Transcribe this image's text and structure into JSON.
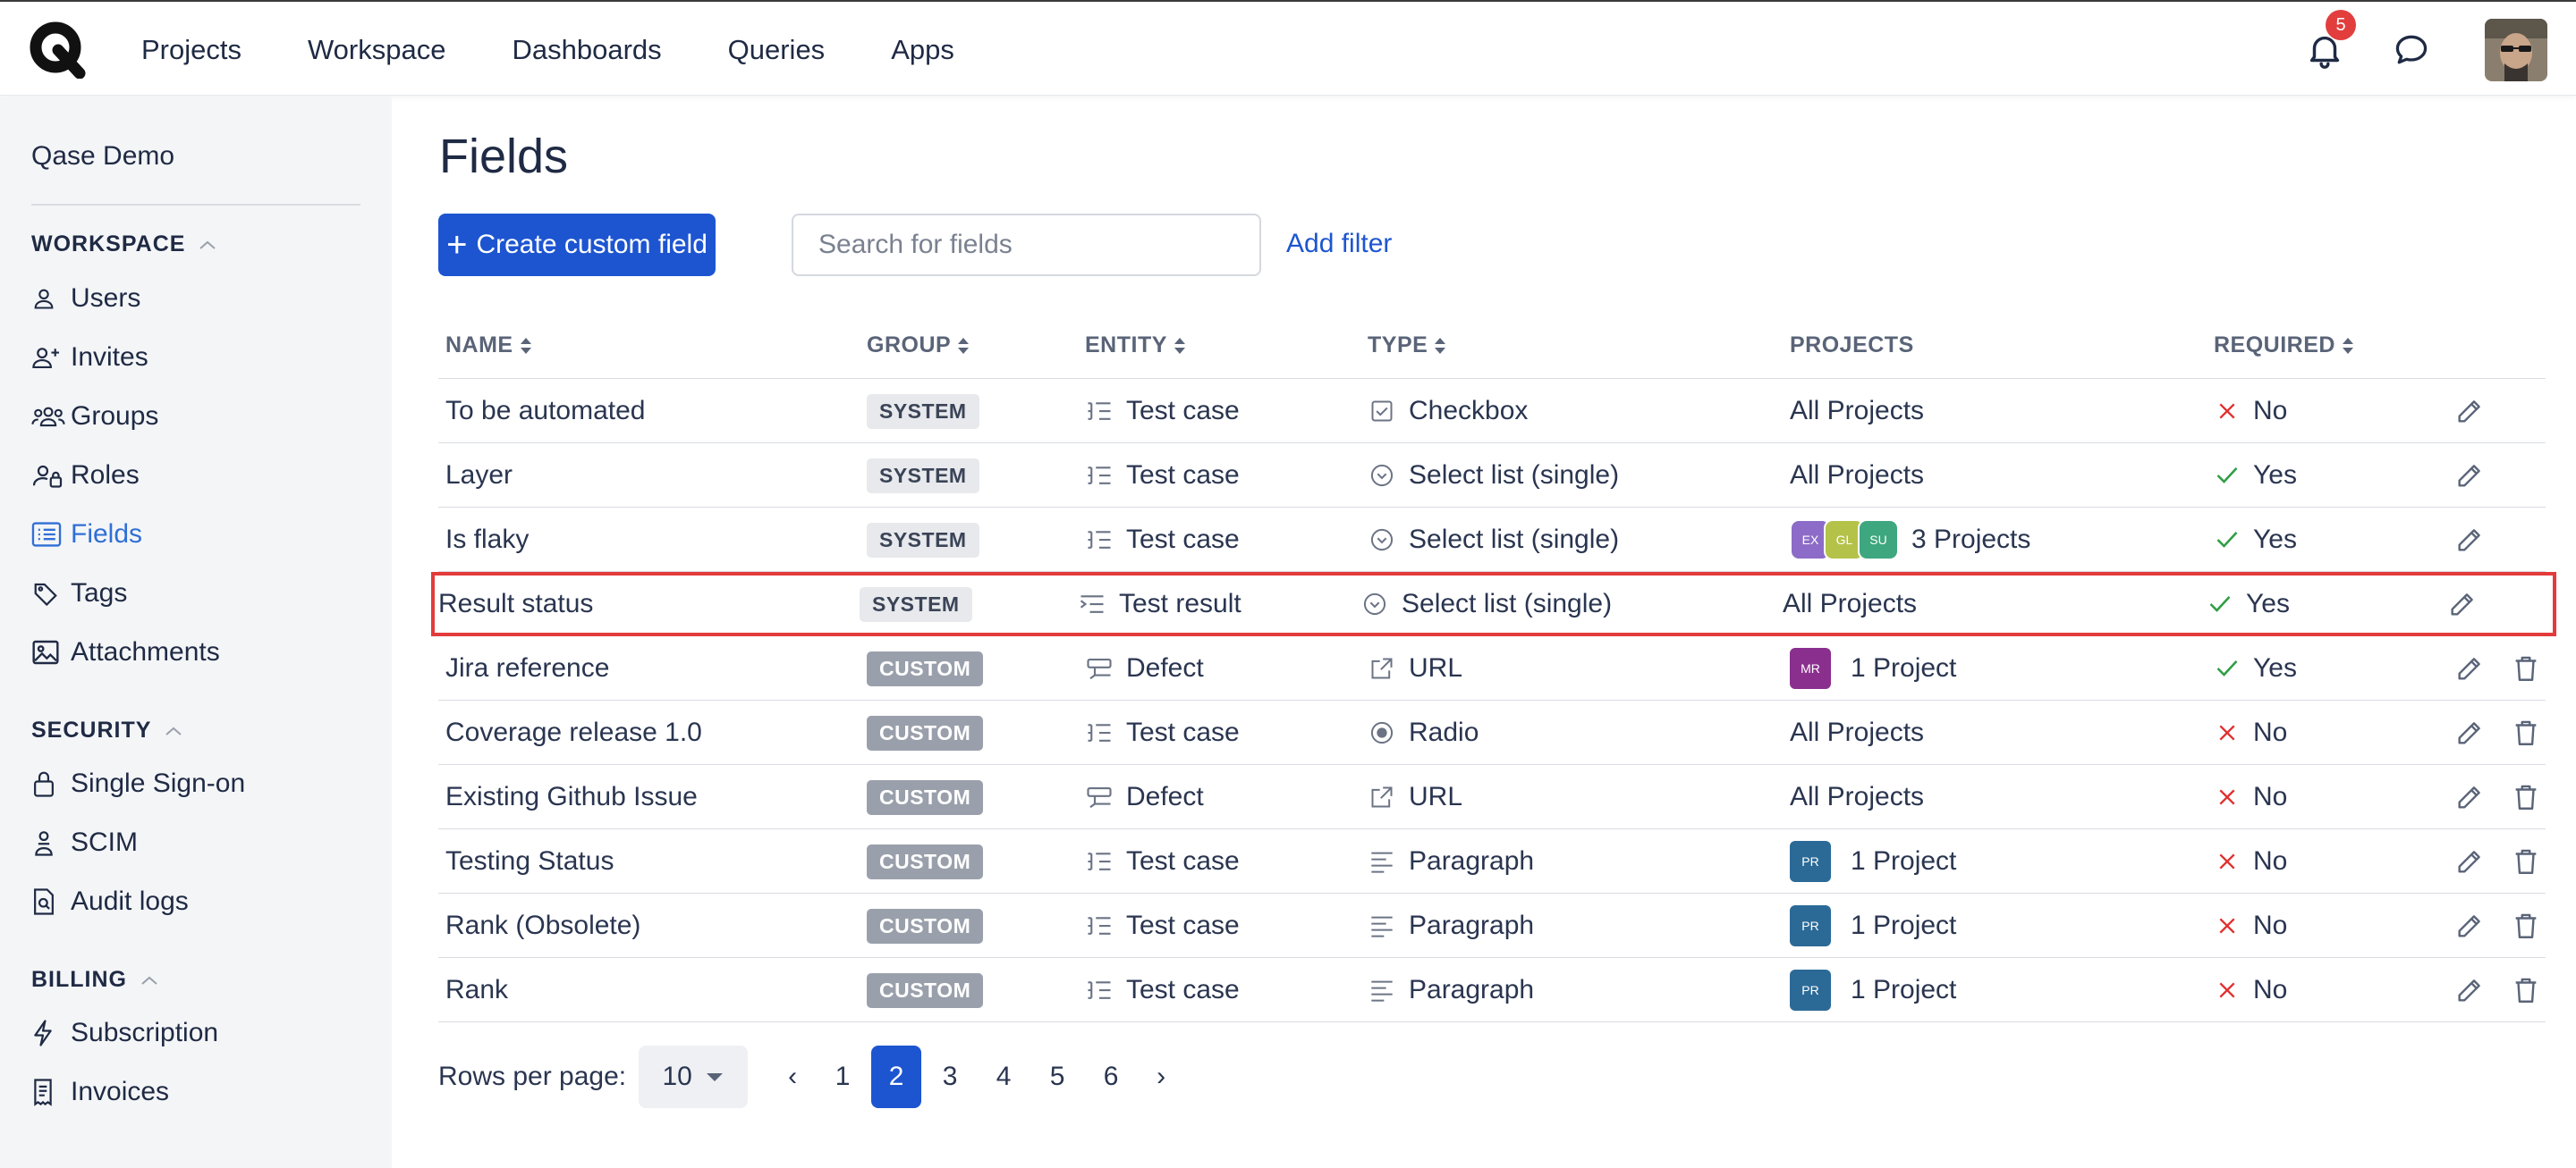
{
  "nav": {
    "items": [
      "Projects",
      "Workspace",
      "Dashboards",
      "Queries",
      "Apps"
    ],
    "notifications_count": "5"
  },
  "sidebar": {
    "workspace_name": "Qase Demo",
    "sections": {
      "workspace": "WORKSPACE",
      "security": "SECURITY",
      "billing": "BILLING"
    },
    "items": {
      "users": "Users",
      "invites": "Invites",
      "groups": "Groups",
      "roles": "Roles",
      "fields": "Fields",
      "tags": "Tags",
      "attachments": "Attachments",
      "sso": "Single Sign-on",
      "scim": "SCIM",
      "audit": "Audit logs",
      "subscription": "Subscription",
      "invoices": "Invoices"
    },
    "active_item": "fields",
    "accent_color": "#2f6fd6"
  },
  "page": {
    "title": "Fields",
    "create_button": "Create custom field",
    "search_placeholder": "Search for fields",
    "add_filter": "Add filter"
  },
  "table": {
    "headers": {
      "name": "NAME",
      "group": "GROUP",
      "entity": "ENTITY",
      "type": "TYPE",
      "projects": "PROJECTS",
      "required": "REQUIRED"
    },
    "rows": [
      {
        "name": "To be automated",
        "group": "SYSTEM",
        "entity": "Test case",
        "entity_icon": "test-case-icon",
        "type": "Checkbox",
        "type_icon": "checkbox-icon",
        "projects": "All Projects",
        "required": "No",
        "deletable": false
      },
      {
        "name": "Layer",
        "group": "SYSTEM",
        "entity": "Test case",
        "entity_icon": "test-case-icon",
        "type": "Select list (single)",
        "type_icon": "select-icon",
        "projects": "All Projects",
        "required": "Yes",
        "deletable": false
      },
      {
        "name": "Is flaky",
        "group": "SYSTEM",
        "entity": "Test case",
        "entity_icon": "test-case-icon",
        "type": "Select list (single)",
        "type_icon": "select-icon",
        "projects": "3 Projects",
        "project_badges": [
          "EX",
          "GL",
          "SU"
        ],
        "required": "Yes",
        "deletable": false
      },
      {
        "name": "Result status",
        "group": "SYSTEM",
        "entity": "Test result",
        "entity_icon": "test-result-icon",
        "type": "Select list (single)",
        "type_icon": "select-icon",
        "projects": "All Projects",
        "required": "Yes",
        "deletable": false,
        "highlighted": true
      },
      {
        "name": "Jira reference",
        "group": "CUSTOM",
        "entity": "Defect",
        "entity_icon": "defect-icon",
        "type": "URL",
        "type_icon": "url-icon",
        "projects": "1 Project",
        "project_badges": [
          "MR"
        ],
        "required": "Yes",
        "deletable": true
      },
      {
        "name": "Coverage release 1.0",
        "group": "CUSTOM",
        "entity": "Test case",
        "entity_icon": "test-case-icon",
        "type": "Radio",
        "type_icon": "radio-icon",
        "projects": "All Projects",
        "required": "No",
        "deletable": true
      },
      {
        "name": "Existing Github Issue",
        "group": "CUSTOM",
        "entity": "Defect",
        "entity_icon": "defect-icon",
        "type": "URL",
        "type_icon": "url-icon",
        "projects": "All Projects",
        "required": "No",
        "deletable": true
      },
      {
        "name": "Testing Status",
        "group": "CUSTOM",
        "entity": "Test case",
        "entity_icon": "test-case-icon",
        "type": "Paragraph",
        "type_icon": "paragraph-icon",
        "projects": "1 Project",
        "project_badges": [
          "PR"
        ],
        "required": "No",
        "deletable": true
      },
      {
        "name": "Rank (Obsolete)",
        "group": "CUSTOM",
        "entity": "Test case",
        "entity_icon": "test-case-icon",
        "type": "Paragraph",
        "type_icon": "paragraph-icon",
        "projects": "1 Project",
        "project_badges": [
          "PR"
        ],
        "required": "No",
        "deletable": true
      },
      {
        "name": "Rank",
        "group": "CUSTOM",
        "entity": "Test case",
        "entity_icon": "test-case-icon",
        "type": "Paragraph",
        "type_icon": "paragraph-icon",
        "projects": "1 Project",
        "project_badges": [
          "PR"
        ],
        "required": "No",
        "deletable": true
      }
    ],
    "badge_colors": {
      "EX": "#8c6cc8",
      "GL": "#b5c24a",
      "SU": "#3ea77f",
      "MR": "#8b2f8f",
      "PR": "#2b6a97"
    },
    "yes_color": "#2f9e44",
    "no_color": "#e03131"
  },
  "pagination": {
    "rows_per_page_label": "Rows per page:",
    "rows_per_page_value": "10",
    "prev": "‹",
    "next": "›",
    "pages": [
      "1",
      "2",
      "3",
      "4",
      "5",
      "6"
    ],
    "current_page": "2"
  }
}
